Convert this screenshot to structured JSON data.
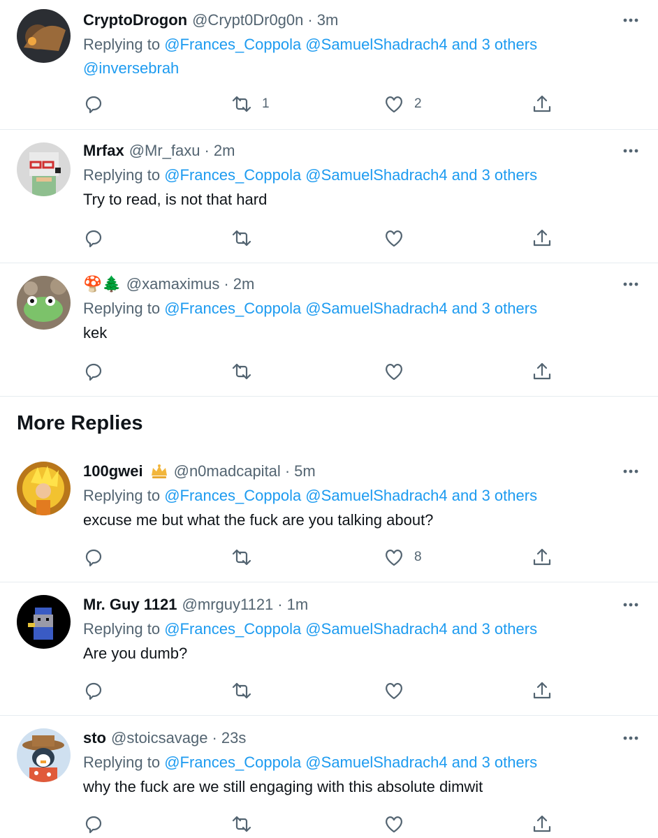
{
  "section": {
    "title": "More Replies"
  },
  "tweets": [
    {
      "name": "CryptoDrogon",
      "handle": "@Crypt0Dr0g0n",
      "time": "3m",
      "replying_prefix": "Replying to",
      "replying_targets": "@Frances_Coppola @SamuelShadrach4 and 3 others",
      "replying_extra": "@inversebrah",
      "text": "",
      "retweets": "1",
      "likes": "2"
    },
    {
      "name": "Mrfax",
      "handle": "@Mr_faxu",
      "time": "2m",
      "replying_prefix": "Replying to",
      "replying_targets": "@Frances_Coppola @SamuelShadrach4 and 3 others",
      "text": "Try to read, is not that hard",
      "retweets": "",
      "likes": ""
    },
    {
      "name": "🍄🌲",
      "handle": "@xamaximus",
      "time": "2m",
      "replying_prefix": "Replying to",
      "replying_targets": "@Frances_Coppola @SamuelShadrach4 and 3 others",
      "text": "kek",
      "retweets": "",
      "likes": ""
    },
    {
      "name": "100gwei",
      "handle": "@n0madcapital",
      "time": "5m",
      "replying_prefix": "Replying to",
      "replying_targets": "@Frances_Coppola @SamuelShadrach4 and 3 others",
      "text": "excuse me but what the fuck are you talking about?",
      "retweets": "",
      "likes": "8"
    },
    {
      "name": "Mr. Guy 1121",
      "handle": "@mrguy1121",
      "time": "1m",
      "replying_prefix": "Replying to",
      "replying_targets": "@Frances_Coppola @SamuelShadrach4 and 3 others",
      "text": "Are you dumb?",
      "retweets": "",
      "likes": ""
    },
    {
      "name": "sto",
      "handle": "@stoicsavage",
      "time": "23s",
      "replying_prefix": "Replying to",
      "replying_targets": "@Frances_Coppola @SamuelShadrach4 and 3 others",
      "text": "why the fuck are we still engaging with this absolute dimwit",
      "retweets": "",
      "likes": ""
    }
  ],
  "separator": "·",
  "icons": {
    "more": "more-horizontal-icon",
    "reply": "reply-bubble-icon",
    "retweet": "retweet-icon",
    "like": "heart-icon",
    "share": "share-icon",
    "badge": "crown-badge-icon"
  },
  "colors": {
    "link": "#1d9bf0",
    "secondary": "#536471",
    "text": "#0f1419",
    "divider": "#e6ecf0"
  }
}
